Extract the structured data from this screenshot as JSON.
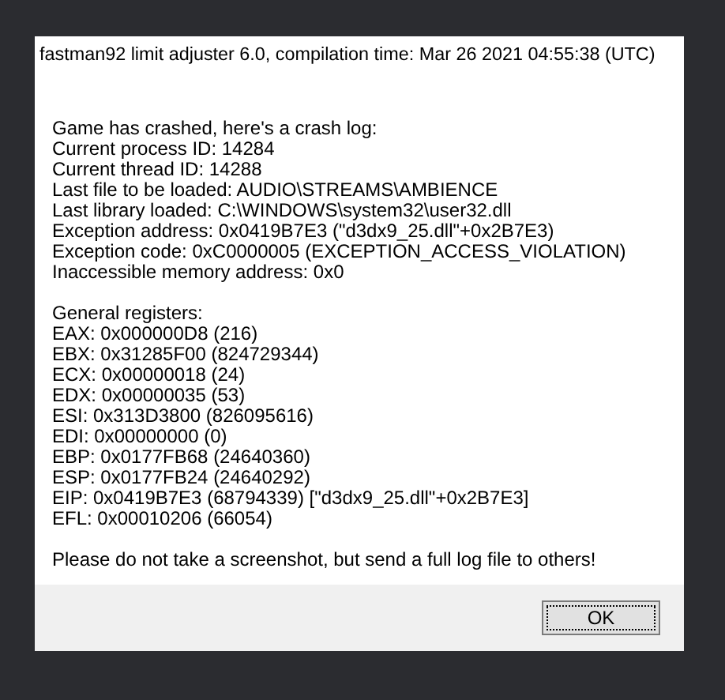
{
  "dialog": {
    "title": "fastman92 limit adjuster 6.0, compilation time: Mar 26 2021 04:55:38 (UTC)",
    "message_groups": [
      [
        "Game has crashed, here's a crash log:",
        "Current process ID: 14284",
        "Current thread ID: 14288",
        "Last file to be loaded: AUDIO\\STREAMS\\AMBIENCE",
        "Last library loaded: C:\\WINDOWS\\system32\\user32.dll",
        "Exception address: 0x0419B7E3 (\"d3dx9_25.dll\"+0x2B7E3)",
        "Exception code: 0xC0000005 (EXCEPTION_ACCESS_VIOLATION)",
        "Inaccessible memory address: 0x0"
      ],
      [
        "General registers:",
        "EAX: 0x000000D8 (216)",
        "EBX: 0x31285F00 (824729344)",
        "ECX: 0x00000018 (24)",
        "EDX: 0x00000035 (53)",
        "ESI: 0x313D3800 (826095616)",
        "EDI: 0x00000000 (0)",
        "EBP: 0x0177FB68 (24640360)",
        "ESP: 0x0177FB24 (24640292)",
        "EIP: 0x0419B7E3 (68794339) [\"d3dx9_25.dll\"+0x2B7E3]",
        "EFL: 0x00010206 (66054)"
      ],
      [
        "Please do not take a screenshot, but send a full log file to others!"
      ]
    ],
    "button": {
      "label": "OK",
      "focused": true
    }
  }
}
